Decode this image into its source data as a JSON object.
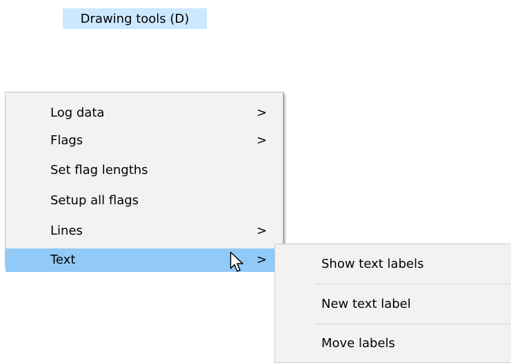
{
  "title": "Drawing tools (D)",
  "menu": {
    "items": [
      {
        "label": "Log data",
        "arrow": ">"
      },
      {
        "label": "Flags",
        "arrow": ">"
      },
      {
        "label": "Set flag lengths",
        "arrow": ""
      },
      {
        "label": "Setup all flags",
        "arrow": ""
      },
      {
        "label": "Lines",
        "arrow": ">"
      },
      {
        "label": "Text",
        "arrow": ">"
      }
    ]
  },
  "submenu": {
    "items": [
      {
        "label": "Show text labels"
      },
      {
        "label": "New text label"
      },
      {
        "label": "Move labels"
      }
    ]
  },
  "colors": {
    "title_bg": "#cce8ff",
    "highlight": "#91c9f7",
    "menu_bg": "#f2f2f2"
  },
  "icons": {
    "cursor": "mouse-pointer-icon",
    "submenu_arrow": "chevron-right-icon"
  }
}
